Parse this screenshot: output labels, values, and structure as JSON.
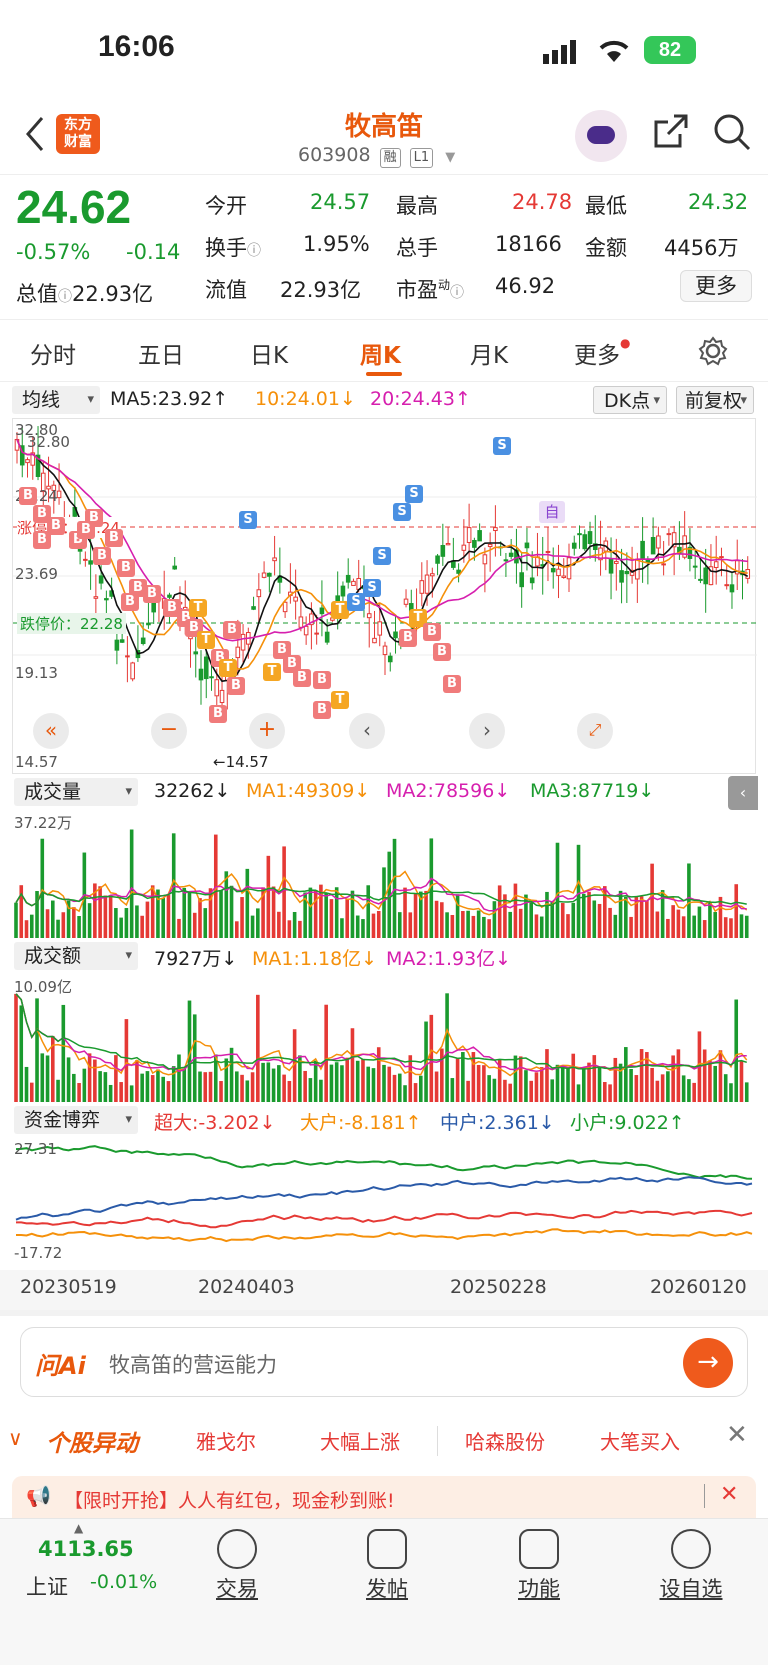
{
  "status": {
    "time": "16:06",
    "battery": "82"
  },
  "header": {
    "logo_line1": "东方",
    "logo_line2": "财富",
    "name": "牧高笛",
    "code": "603908",
    "tag1": "融",
    "tag2": "L1"
  },
  "quote": {
    "price": "24.62",
    "change_pct": "-0.57%",
    "change": "-0.14",
    "open_label": "今开",
    "open": "24.57",
    "high_label": "最高",
    "high": "24.78",
    "low_label": "最低",
    "low": "24.32",
    "turnover_label": "换手",
    "turnover": "1.95%",
    "volume_label": "总手",
    "volume": "18166",
    "amount_label": "金额",
    "amount": "4456万",
    "mktcap_label": "总值",
    "mktcap": "22.93亿",
    "float_label": "流值",
    "float": "22.93亿",
    "pe_label": "市盈",
    "pe_sup": "动",
    "pe": "46.92",
    "more": "更多"
  },
  "tabs": [
    "分时",
    "五日",
    "日K",
    "周K",
    "月K",
    "更多"
  ],
  "active_tab": "周K",
  "toolbar": {
    "indicator": "均线",
    "ma5": "MA5:23.92↑",
    "ma10": "10:24.01↓",
    "ma20": "20:24.43↑",
    "dk": "DK点",
    "adjust": "前复权"
  },
  "kchart": {
    "y_top": "32.80",
    "y_top2": "32.80",
    "y2": "28.24",
    "y3": "23.69",
    "y4": "19.13",
    "y_bottom": "14.57",
    "limit_up_label": "涨停价：27.24",
    "limit_down_label": "跌停价：22.28",
    "low_mark": "←14.57",
    "self_tag": "自",
    "buy": "B",
    "sell": "S",
    "t": "T"
  },
  "volume": {
    "label": "成交量",
    "value": "32262↓",
    "ma1": "MA1:49309↓",
    "ma2": "MA2:78596↓",
    "ma3": "MA3:87719↓",
    "ymax": "37.22万"
  },
  "amount": {
    "label": "成交额",
    "value": "7927万↓",
    "ma1": "MA1:1.18亿↓",
    "ma2": "MA2:1.93亿↓",
    "ymax": "10.09亿"
  },
  "capital": {
    "label": "资金博弈",
    "super": "超大:-3.202↓",
    "big": "大户:-8.181↑",
    "mid": "中户:2.361↓",
    "small": "小户:9.022↑",
    "ymax": "27.31",
    "ymin": "-17.72"
  },
  "dates": [
    "20230519",
    "20240403",
    "20250228",
    "20260120"
  ],
  "askai": {
    "brand": "问Ai",
    "placeholder": "牧高笛的营运能力"
  },
  "alerts": {
    "title": "个股异动",
    "items": [
      "雅戈尔",
      "大幅上涨",
      "哈森股份",
      "大笔买入"
    ]
  },
  "promo": {
    "text": "【限时开抢】人人有红包，现金秒到账!"
  },
  "bottom": {
    "index_value": "4113.65",
    "index_name": "上证",
    "index_change": "-0.01%",
    "items": [
      "交易",
      "发帖",
      "功能",
      "设自选"
    ]
  },
  "colors": {
    "up": "#e53935",
    "down": "#1a9a2e",
    "accent": "#e8580c",
    "ma10": "#f5900a",
    "ma20": "#d61fae"
  }
}
